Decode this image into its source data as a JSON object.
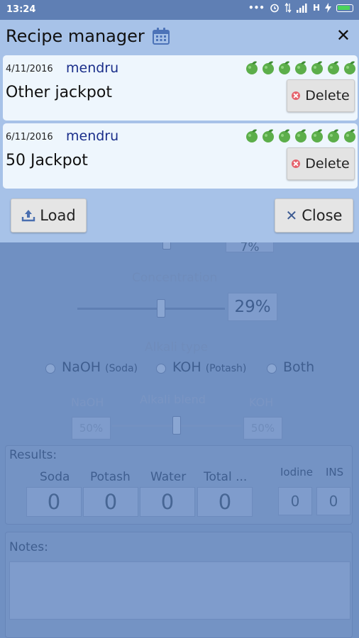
{
  "status_bar": {
    "time": "13:24",
    "network": "H"
  },
  "dialog": {
    "title": "Recipe manager",
    "recipes": [
      {
        "date": "4/11/2016",
        "author": "mendru",
        "name": "Other jackpot",
        "rating": 7,
        "delete_label": "Delete"
      },
      {
        "date": "6/11/2016",
        "author": "mendru",
        "name": "50 Jackpot",
        "rating": 7,
        "delete_label": "Delete"
      }
    ],
    "load_label": "Load",
    "close_label": "Close"
  },
  "background": {
    "partial_value": "7%",
    "concentration_label": "Concentration",
    "concentration_value": "29%",
    "alkali_type_label": "Alkali type",
    "alkali_options": [
      {
        "label": "NaOH",
        "sub": "(Soda)"
      },
      {
        "label": "KOH",
        "sub": "(Potash)"
      },
      {
        "label": "Both",
        "sub": ""
      }
    ],
    "blend_label": "Alkali blend",
    "naoh_label": "NaOH",
    "koh_label": "KOH",
    "naoh_value": "50%",
    "koh_value": "50%",
    "results_label": "Results:",
    "results_columns": [
      "Soda",
      "Potash",
      "Water",
      "Total ..."
    ],
    "results_values": [
      "0",
      "0",
      "0",
      "0"
    ],
    "iodine_label": "Iodine",
    "ins_label": "INS",
    "iodine_value": "0",
    "ins_value": "0",
    "notes_label": "Notes:"
  },
  "colors": {
    "dialog_bg": "#a7c2e8",
    "card_bg": "#eef6fd",
    "author": "#1a2e8a",
    "rating_dot": "#5cae4a",
    "delete_dot": "#e5636d"
  }
}
